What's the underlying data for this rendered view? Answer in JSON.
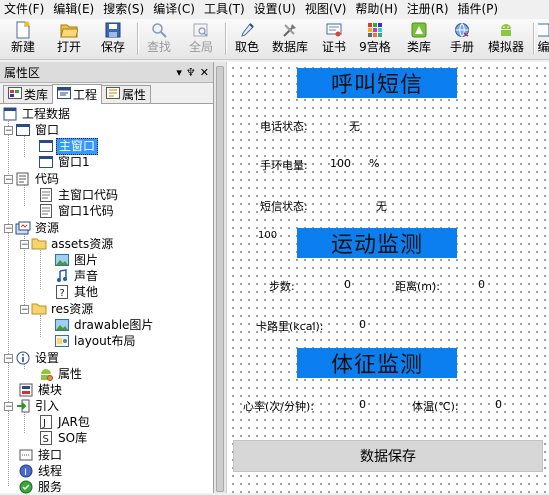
{
  "menu": [
    {
      "label": "文件(F)"
    },
    {
      "label": "编辑(E)"
    },
    {
      "label": "搜索(S)"
    },
    {
      "label": "编译(C)"
    },
    {
      "label": "工具(T)"
    },
    {
      "label": "设置(U)"
    },
    {
      "label": "视图(V)"
    },
    {
      "label": "帮助(H)"
    },
    {
      "label": "注册(R)"
    },
    {
      "label": "插件(P)"
    }
  ],
  "toolbar": {
    "new": "新建",
    "open": "打开",
    "save": "保存",
    "find": "查找",
    "global": "全局",
    "color_pick": "取色",
    "database": "数据库",
    "certificate": "证书",
    "nine_grid": "9宫格",
    "class_lib": "类库",
    "manual": "手册",
    "emulator": "模拟器",
    "edit_partial": "编"
  },
  "panel": {
    "title": "属性区",
    "controls": {
      "dropdown": "▾",
      "pin": "♆",
      "close": "✕"
    },
    "tabs": {
      "lib": "类库",
      "project": "工程",
      "props": "属性"
    }
  },
  "tree": {
    "root": "工程数据",
    "window": "窗口",
    "main_window": "主窗口",
    "window1": "窗口1",
    "code": "代码",
    "main_code": "主窗口代码",
    "window1_code": "窗口1代码",
    "resources": "资源",
    "assets": "assets资源",
    "images": "图片",
    "sounds": "声音",
    "others": "其他",
    "res": "res资源",
    "drawable": "drawable图片",
    "layout": "layout布局",
    "settings": "设置",
    "attributes": "属性",
    "modules": "模块",
    "imports": "引入",
    "jar": "JAR包",
    "so": "SO库",
    "interfaces": "接口",
    "threads": "线程",
    "services": "服务"
  },
  "design": {
    "heading_call": "呼叫短信",
    "phone_state_label": "电话状态:",
    "phone_state_value": "无",
    "battery_label": "手环电量:",
    "battery_value": "100",
    "battery_unit": "%",
    "sms_state_label": "短信状态:",
    "sms_state_value": "无",
    "progress_value": "100",
    "heading_motion": "运动监测",
    "steps_label": "步数:",
    "steps_value": "0",
    "distance_label": "距离(m):",
    "distance_value": "0",
    "calories_label": "卡路里(kcal):",
    "calories_value": "0",
    "heading_vitals": "体征监测",
    "heart_rate_label": "心率(次/分钟):",
    "heart_rate_value": "0",
    "temperature_label": "体温(℃):",
    "temperature_value": "0",
    "save_button": "数据保存"
  },
  "colors": {
    "heading_bg": "#0b7ff0",
    "selection": "#3399ff"
  }
}
